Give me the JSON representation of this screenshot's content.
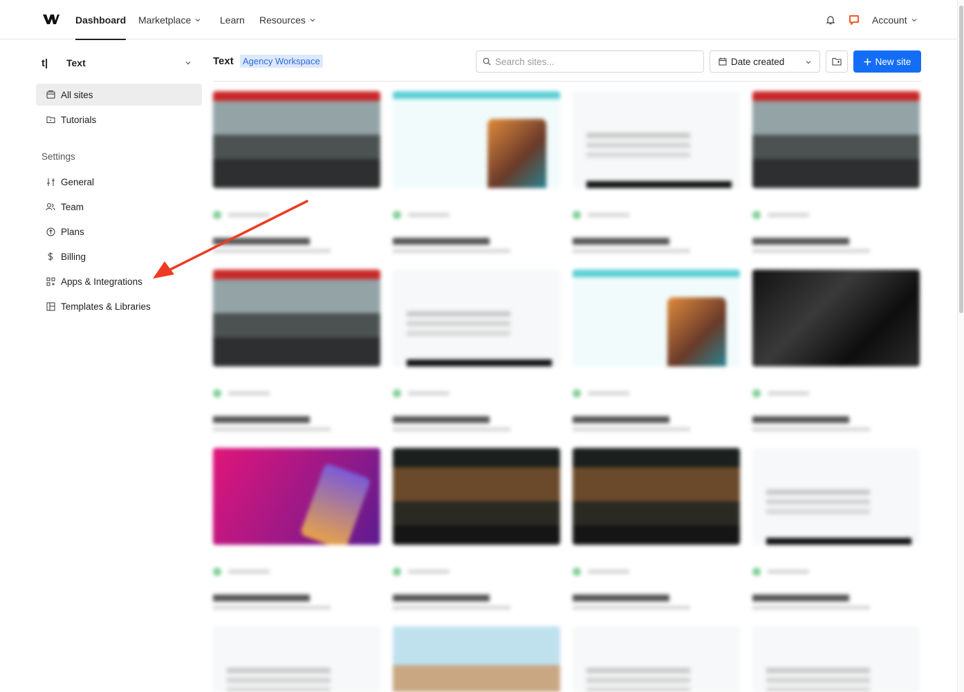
{
  "topnav": {
    "tabs": [
      {
        "label": "Dashboard"
      },
      {
        "label": "Marketplace"
      },
      {
        "label": "Learn"
      },
      {
        "label": "Resources"
      }
    ],
    "account_label": "Account",
    "brand_color": "#146ef5"
  },
  "sidebar": {
    "workspace_initial": "t|",
    "workspace_name": "Text",
    "items": [
      {
        "label": "All sites",
        "icon": "browser-icon"
      },
      {
        "label": "Tutorials",
        "icon": "folder-icon"
      }
    ],
    "settings_heading": "Settings",
    "settings_items": [
      {
        "label": "General",
        "icon": "sliders-icon"
      },
      {
        "label": "Team",
        "icon": "team-icon"
      },
      {
        "label": "Plans",
        "icon": "plans-icon"
      },
      {
        "label": "Billing",
        "icon": "dollar-icon"
      },
      {
        "label": "Apps & Integrations",
        "icon": "apps-icon"
      },
      {
        "label": "Templates & Libraries",
        "icon": "template-icon"
      }
    ]
  },
  "main": {
    "workspace_title": "Text",
    "workspace_badge": "Agency Workspace",
    "search_placeholder": "Search sites...",
    "sort_label": "Date created",
    "new_site_label": "New site"
  },
  "annotation": {
    "arrow_color": "#ee3b24",
    "points_to": "Apps & Integrations"
  }
}
